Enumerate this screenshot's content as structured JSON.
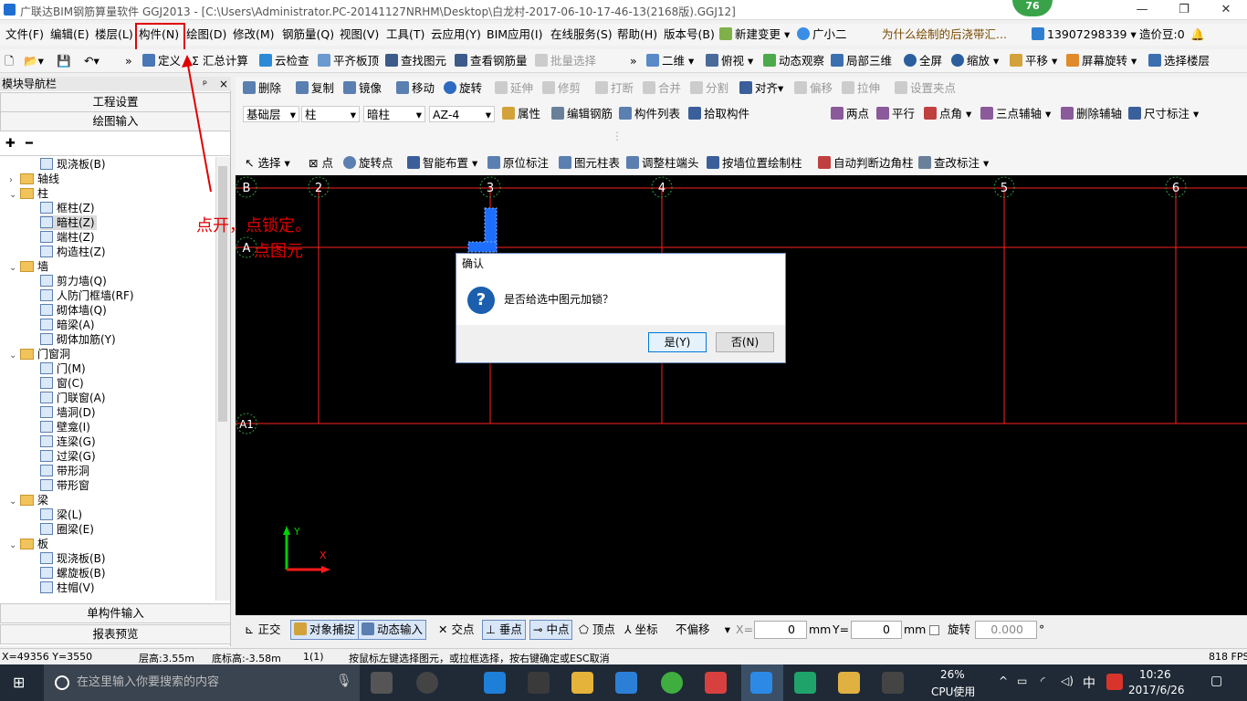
{
  "title_bar": {
    "title": "广联达BIM钢筋算量软件 GGJ2013 - [C:\\Users\\Administrator.PC-20141127NRHM\\Desktop\\白龙村-2017-06-10-17-46-13(2168版).GGJ12]",
    "badge": "76",
    "minimize": "—",
    "restore": "❐",
    "close": "✕"
  },
  "menu": {
    "items": [
      "文件(F)",
      "编辑(E)",
      "楼层(L)",
      "构件(N)",
      "绘图(D)",
      "修改(M)",
      "钢筋量(Q)",
      "视图(V)",
      "工具(T)",
      "云应用(Y)",
      "BIM应用(I)",
      "在线服务(S)",
      "帮助(H)",
      "版本号(B)"
    ],
    "new_change": "新建变更",
    "assistant": "广小二",
    "question": "为什么绘制的后浇带汇...",
    "phone": "13907298339",
    "cost_beans": "造价豆:0"
  },
  "toolbar1": {
    "items": [
      "定义",
      "汇总计算",
      "云检查",
      "平齐板顶",
      "查找图元",
      "查看钢筋量",
      "批量选择"
    ],
    "view_items": [
      "二维",
      "俯视",
      "动态观察",
      "局部三维",
      "全屏",
      "缩放",
      "平移",
      "屏幕旋转",
      "选择楼层"
    ]
  },
  "left_panel": {
    "title": "模块导航栏",
    "pin": "ᵖ",
    "close": "×",
    "btn_project": "工程设置",
    "btn_draw": "绘图输入",
    "btn_single": "单构件输入",
    "btn_report": "报表预览",
    "tree": [
      {
        "label": "现浇板(B)",
        "level": 2,
        "type": "item"
      },
      {
        "label": "轴线",
        "level": 1,
        "type": "folder",
        "expander": "›"
      },
      {
        "label": "柱",
        "level": 1,
        "type": "folder",
        "expander": "⌄"
      },
      {
        "label": "框柱(Z)",
        "level": 2,
        "type": "item"
      },
      {
        "label": "暗柱(Z)",
        "level": 2,
        "type": "item",
        "selected": true
      },
      {
        "label": "端柱(Z)",
        "level": 2,
        "type": "item"
      },
      {
        "label": "构造柱(Z)",
        "level": 2,
        "type": "item"
      },
      {
        "label": "墙",
        "level": 1,
        "type": "folder",
        "expander": "⌄"
      },
      {
        "label": "剪力墙(Q)",
        "level": 2,
        "type": "item"
      },
      {
        "label": "人防门框墙(RF)",
        "level": 2,
        "type": "item"
      },
      {
        "label": "砌体墙(Q)",
        "level": 2,
        "type": "item"
      },
      {
        "label": "暗梁(A)",
        "level": 2,
        "type": "item"
      },
      {
        "label": "砌体加筋(Y)",
        "level": 2,
        "type": "item"
      },
      {
        "label": "门窗洞",
        "level": 1,
        "type": "folder",
        "expander": "⌄"
      },
      {
        "label": "门(M)",
        "level": 2,
        "type": "item"
      },
      {
        "label": "窗(C)",
        "level": 2,
        "type": "item"
      },
      {
        "label": "门联窗(A)",
        "level": 2,
        "type": "item"
      },
      {
        "label": "墙洞(D)",
        "level": 2,
        "type": "item"
      },
      {
        "label": "壁龛(I)",
        "level": 2,
        "type": "item"
      },
      {
        "label": "连梁(G)",
        "level": 2,
        "type": "item"
      },
      {
        "label": "过梁(G)",
        "level": 2,
        "type": "item"
      },
      {
        "label": "带形洞",
        "level": 2,
        "type": "item"
      },
      {
        "label": "带形窗",
        "level": 2,
        "type": "item"
      },
      {
        "label": "梁",
        "level": 1,
        "type": "folder",
        "expander": "⌄"
      },
      {
        "label": "梁(L)",
        "level": 2,
        "type": "item"
      },
      {
        "label": "圈梁(E)",
        "level": 2,
        "type": "item"
      },
      {
        "label": "板",
        "level": 1,
        "type": "folder",
        "expander": "⌄"
      },
      {
        "label": "现浇板(B)",
        "level": 2,
        "type": "item"
      },
      {
        "label": "螺旋板(B)",
        "level": 2,
        "type": "item"
      },
      {
        "label": "柱帽(V)",
        "level": 2,
        "type": "item"
      }
    ]
  },
  "edit_bar": {
    "items": [
      "删除",
      "复制",
      "镜像",
      "移动",
      "旋转",
      "延伸",
      "修剪",
      "打断",
      "合并",
      "分割",
      "对齐",
      "偏移",
      "拉伸",
      "设置夹点"
    ]
  },
  "props_bar": {
    "floor": "基础层",
    "category": "柱",
    "type": "暗柱",
    "component": "AZ-4",
    "items": [
      "属性",
      "编辑钢筋",
      "构件列表",
      "拾取构件"
    ],
    "right_items": [
      "两点",
      "平行",
      "点角",
      "三点辅轴",
      "删除辅轴",
      "尺寸标注"
    ]
  },
  "draw_bar": {
    "items": [
      "选择",
      "点",
      "旋转点",
      "智能布置",
      "原位标注",
      "图元柱表",
      "调整柱端头",
      "按墙位置绘制柱",
      "自动判断边角柱",
      "查改标注"
    ]
  },
  "canvas": {
    "axis_labels_top": [
      "B",
      "2",
      "3",
      "4",
      "5",
      "6"
    ],
    "axis_labels_left": [
      "A",
      "A1"
    ],
    "ucs_y": "Y",
    "ucs_x": "X"
  },
  "annotation": {
    "line1": "点开，点锁定。",
    "line2": "点图元"
  },
  "dialog": {
    "title": "确认",
    "icon": "?",
    "message": "是否给选中图元加锁？",
    "yes": "是(Y)",
    "no": "否(N)"
  },
  "bottom_bar": {
    "items": [
      "正交",
      "对象捕捉",
      "动态输入",
      "交点",
      "垂点",
      "中点",
      "顶点",
      "坐标"
    ],
    "offset_mode": "不偏移",
    "x_label": "X=",
    "x_value": "0",
    "y_label": "Y=",
    "y_value": "0",
    "unit": "mm",
    "rotate_label": "旋转",
    "rotate_value": "0.000",
    "degree": "°"
  },
  "status_bar": {
    "coords": "X=49356 Y=3550",
    "floor_height": "层高:3.55m",
    "bottom_height": "底标高:-3.58m",
    "count": "1(1)",
    "hint": "按鼠标左键选择图元，或拉框选择，按右键确定或ESC取消",
    "fps": "818 FPS"
  },
  "taskbar": {
    "search_placeholder": "在这里输入你要搜索的内容",
    "cpu_percent": "26%",
    "cpu_label": "CPU使用",
    "ime": "中",
    "time": "10:26",
    "date": "2017/6/26"
  },
  "colors": {
    "canvas_bg": "#000000",
    "axis_line": "#ff2020",
    "axis_circle": "#2ea043",
    "column": "#1e6fff",
    "annotation": "#e10000",
    "dialog_icon": "#1b5fae",
    "badge": "#3aa34a"
  }
}
